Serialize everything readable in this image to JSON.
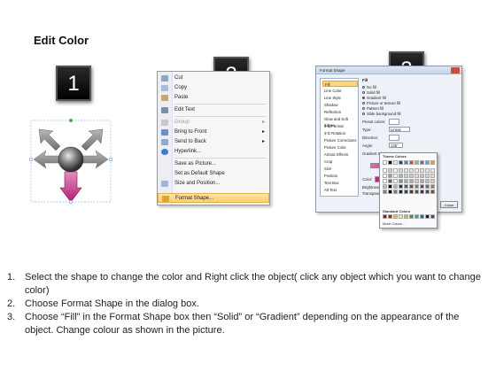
{
  "title": "Edit Color",
  "badges": [
    "1",
    "2",
    "3"
  ],
  "context_menu": {
    "items": [
      {
        "label": "Cut",
        "icon": "scissors-icon",
        "underline": "t",
        "disabled": false,
        "submenu": false
      },
      {
        "label": "Copy",
        "icon": "copy-icon",
        "disabled": false,
        "submenu": false
      },
      {
        "label": "Paste",
        "icon": "paste-icon",
        "disabled": false,
        "submenu": false
      },
      {
        "label": "Edit Text",
        "icon": "edit-text-icon",
        "disabled": false,
        "submenu": false
      },
      {
        "label": "Group",
        "icon": "group-icon",
        "disabled": true,
        "submenu": true
      },
      {
        "label": "Bring to Front",
        "icon": "bring-front-icon",
        "disabled": false,
        "submenu": true
      },
      {
        "label": "Send to Back",
        "icon": "send-back-icon",
        "disabled": false,
        "submenu": true
      },
      {
        "label": "Hyperlink...",
        "icon": "hyperlink-icon",
        "disabled": false,
        "submenu": false
      },
      {
        "label": "Save as Picture...",
        "icon": "",
        "disabled": false,
        "submenu": false
      },
      {
        "label": "Set as Default Shape",
        "icon": "",
        "disabled": false,
        "submenu": false
      },
      {
        "label": "Size and Position...",
        "icon": "size-icon",
        "disabled": false,
        "submenu": false
      },
      {
        "label": "Format Shape...",
        "icon": "format-shape-icon",
        "disabled": false,
        "submenu": false,
        "highlighted": true
      }
    ]
  },
  "format_dialog": {
    "title": "Format Shape",
    "categories": [
      "Fill",
      "Line Color",
      "Line Style",
      "Shadow",
      "Reflection",
      "Glow and Soft Edges",
      "3-D Format",
      "3-D Rotation",
      "Picture Corrections",
      "Picture Color",
      "Artistic Effects",
      "Crop",
      "Size",
      "Position",
      "Text Box",
      "Alt Text"
    ],
    "selected_category": "Fill",
    "section_title": "Fill",
    "fill_options": [
      "No fill",
      "Solid fill",
      "Gradient fill",
      "Picture or texture fill",
      "Pattern fill",
      "Slide background fill"
    ],
    "selected_fill": "Gradient fill",
    "labels": {
      "preset": "Preset colors:",
      "type": "Type:",
      "type_value": "Linear",
      "direction": "Direction:",
      "angle": "Angle:",
      "angle_value": "135°",
      "stops": "Gradient stops",
      "color": "Color:",
      "position": "Position:",
      "position_value": "0%",
      "brightness": "Brightness:",
      "transparency": "Transparency:",
      "rotate": "Rotate with shape"
    },
    "close_label": "Close"
  },
  "palette": {
    "theme_label": "Theme Colors",
    "standard_label": "Standard Colors",
    "more_label": "More Colors...",
    "theme_top": [
      "#ffffff",
      "#000000",
      "#eeece1",
      "#1f497d",
      "#4f81bd",
      "#c0504d",
      "#9bbb59",
      "#8064a2",
      "#4bacc6",
      "#f79646"
    ],
    "standard": [
      "#c00000",
      "#ff0000",
      "#ffc000",
      "#ffff00",
      "#92d050",
      "#00b050",
      "#00b0f0",
      "#0070c0",
      "#002060",
      "#7030a0"
    ]
  },
  "steps": [
    {
      "num": "1.",
      "text": "Select the shape to change the color and Right click the object( click any object which you want to change color)"
    },
    {
      "num": "2.",
      "text": "Choose Format Shape in the dialog box."
    },
    {
      "num": "3.",
      "text": "Choose “Fill” in the Format Shape box then “Solid” or “Gradient” depending on the appearance of the object. Change colour as shown in the picture."
    }
  ]
}
